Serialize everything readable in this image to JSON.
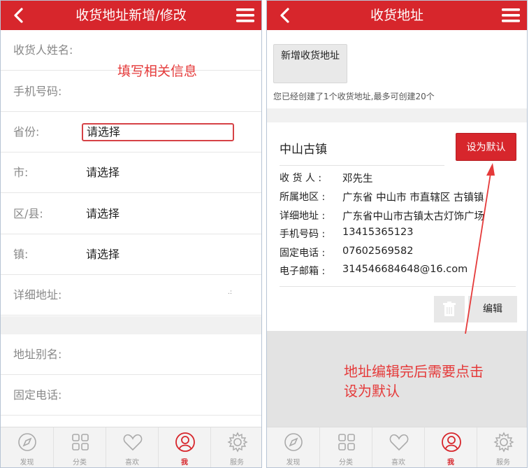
{
  "left": {
    "title": "收货地址新增/修改",
    "hint": "填写相关信息",
    "fields": [
      {
        "label": "收货人姓名:",
        "value": ""
      },
      {
        "label": "手机号码:",
        "value": ""
      },
      {
        "label": "省份:",
        "value": "请选择"
      },
      {
        "label": "市:",
        "value": "请选择"
      },
      {
        "label": "区/县:",
        "value": "请选择"
      },
      {
        "label": "镇:",
        "value": "请选择"
      },
      {
        "label": "详细地址:",
        "value": ""
      },
      {
        "label": "地址别名:",
        "value": ""
      },
      {
        "label": "固定电话:",
        "value": ""
      }
    ]
  },
  "right": {
    "title": "收货地址",
    "new_address_button": "新增收货地址",
    "created_note": "您已经创建了1个收货地址,最多可创建20个",
    "card": {
      "name": "中山古镇",
      "set_default_button": "设为默认",
      "rows": [
        {
          "key": "收 货 人 :",
          "value": "邓先生"
        },
        {
          "key": "所属地区 :",
          "value": "广东省 中山市 市直辖区 古镇镇"
        },
        {
          "key": "详细地址 :",
          "value": "广东省中山市古镇太古灯饰广场"
        },
        {
          "key": "手机号码 :",
          "value": "13415365123"
        },
        {
          "key": "固定电话 :",
          "value": "07602569582"
        },
        {
          "key": "电子邮箱 :",
          "value": "314546684648@16.com"
        }
      ],
      "edit_button": "编辑"
    },
    "annotation_line1": "地址编辑完后需要点击",
    "annotation_line2": "设为默认"
  },
  "tabbar": [
    {
      "label": "发现",
      "icon": "compass-icon"
    },
    {
      "label": "分类",
      "icon": "grid-icon"
    },
    {
      "label": "喜欢",
      "icon": "heart-icon"
    },
    {
      "label": "我",
      "icon": "user-icon"
    },
    {
      "label": "服务",
      "icon": "gear-icon"
    }
  ],
  "colors": {
    "accent": "#d7262c",
    "annotation": "#e53a3a"
  }
}
